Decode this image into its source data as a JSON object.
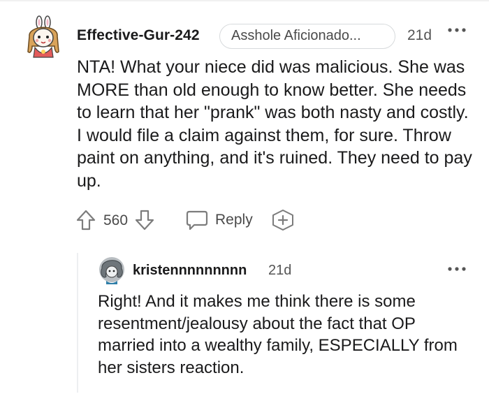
{
  "comment": {
    "username": "Effective-Gur-242",
    "flair": "Asshole Aficionado...",
    "time": "21d",
    "body": "NTA! What your niece did was malicious. She was MORE than old enough to know better. She needs to learn that her \"prank\" was both nasty and costly. I would file a claim against them, for sure. Throw paint on anything, and it's ruined. They need to pay up.",
    "score": "560",
    "reply_label": "Reply",
    "icons": {
      "more": "more-options-icon",
      "upvote": "upvote-arrow-icon",
      "downvote": "downvote-arrow-icon",
      "reply": "speech-bubble-icon",
      "award": "add-award-icon"
    }
  },
  "reply": {
    "username": "kristennnnnnnnn",
    "time": "21d",
    "body": "Right! And it makes me think there is some resentment/jealousy about the fact that OP married into a wealthy family, ESPECIALLY from her sisters reaction."
  },
  "colors": {
    "text": "#1a1a1b",
    "meta": "#555555",
    "icon": "#7c7c7c",
    "border": "#d7dadc",
    "thread_line": "#edeff1"
  }
}
